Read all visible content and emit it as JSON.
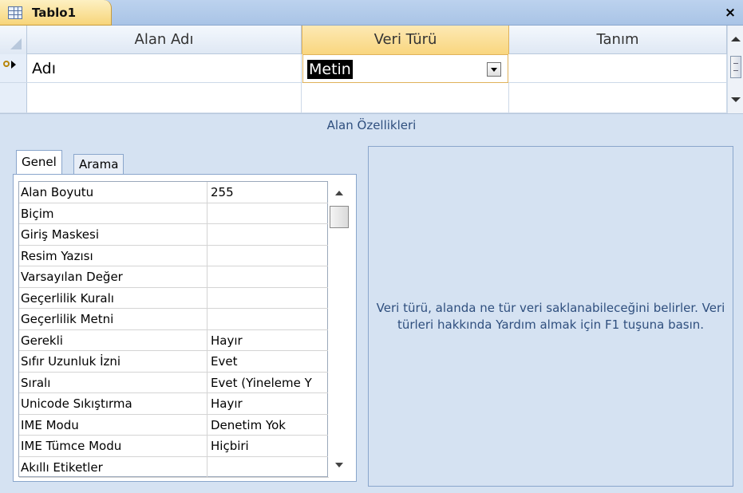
{
  "tab": {
    "title": "Tablo1",
    "close": "×"
  },
  "grid": {
    "columns": [
      "Alan Adı",
      "Veri Türü",
      "Tanım"
    ],
    "rows": [
      {
        "field_name": "Adı",
        "data_type": "Metin",
        "description": ""
      }
    ]
  },
  "field_properties_label": "Alan Özellikleri",
  "property_tabs": [
    "Genel",
    "Arama"
  ],
  "properties": [
    {
      "name": "Alan Boyutu",
      "value": "255"
    },
    {
      "name": "Biçim",
      "value": ""
    },
    {
      "name": "Giriş Maskesi",
      "value": ""
    },
    {
      "name": "Resim Yazısı",
      "value": ""
    },
    {
      "name": "Varsayılan Değer",
      "value": ""
    },
    {
      "name": "Geçerlilik Kuralı",
      "value": ""
    },
    {
      "name": "Geçerlilik Metni",
      "value": ""
    },
    {
      "name": "Gerekli",
      "value": "Hayır"
    },
    {
      "name": "Sıfır Uzunluk İzni",
      "value": "Evet"
    },
    {
      "name": "Sıralı",
      "value": "Evet (Yineleme Y"
    },
    {
      "name": "Unicode Sıkıştırma",
      "value": "Hayır"
    },
    {
      "name": "IME Modu",
      "value": "Denetim Yok"
    },
    {
      "name": "IME Tümce Modu",
      "value": "Hiçbiri"
    },
    {
      "name": "Akıllı Etiketler",
      "value": ""
    }
  ],
  "help_text": "Veri türü, alanda ne tür veri saklanabileceğini belirler. Veri türleri hakkında Yardım almak için F1 tuşuna basın."
}
